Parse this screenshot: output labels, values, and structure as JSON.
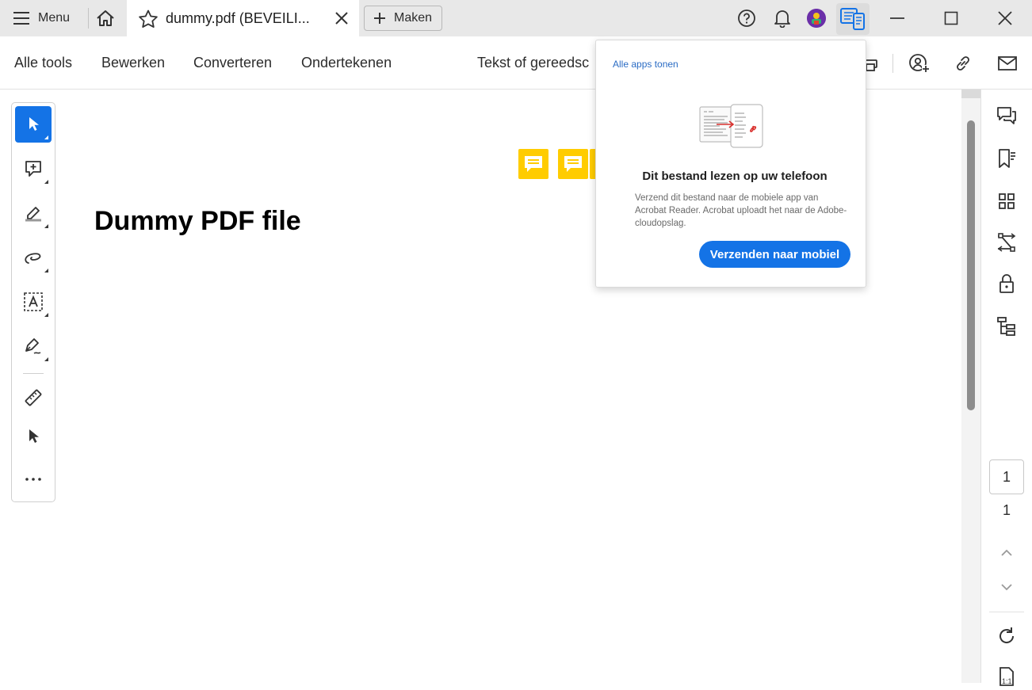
{
  "titlebar": {
    "menu_label": "Menu",
    "tab_title": "dummy.pdf (BEVEILI...",
    "create_label": "Maken"
  },
  "toolsbar": {
    "items": [
      "Alle tools",
      "Bewerken",
      "Converteren",
      "Ondertekenen"
    ],
    "search_text": "Tekst of gereedsc"
  },
  "document": {
    "title": "Dummy PDF file"
  },
  "popup": {
    "all_apps_link": "Alle apps tonen",
    "heading": "Dit bestand lezen op uw telefoon",
    "body": "Verzend dit bestand naar de mobiele app van Acrobat Reader. Acrobat uploadt het naar de Adobe-cloudopslag.",
    "button_label": "Verzenden naar mobiel"
  },
  "pager": {
    "current_page": "1",
    "total_pages": "1"
  },
  "colors": {
    "accent": "#1473e6",
    "note": "#ffcc00"
  },
  "icons": {
    "titlebar": [
      "hamburger-icon",
      "home-icon",
      "star-icon",
      "close-icon",
      "plus-icon",
      "help-icon",
      "bell-icon",
      "avatar",
      "mobile-link-icon",
      "minimize-icon",
      "maximize-icon",
      "close-window-icon"
    ],
    "left_tools": [
      "select-arrow-icon",
      "add-comment-icon",
      "highlight-icon",
      "draw-freeform-icon",
      "text-select-icon",
      "sign-pen-icon",
      "measure-ruler-icon",
      "cursor-icon",
      "more-icon"
    ],
    "right_pane": [
      "comments-icon",
      "bookmarks-icon",
      "thumbnails-icon",
      "compare-icon",
      "protect-icon",
      "structure-icon",
      "chevron-up-icon",
      "chevron-down-icon",
      "rotate-icon",
      "actual-size-icon"
    ]
  }
}
